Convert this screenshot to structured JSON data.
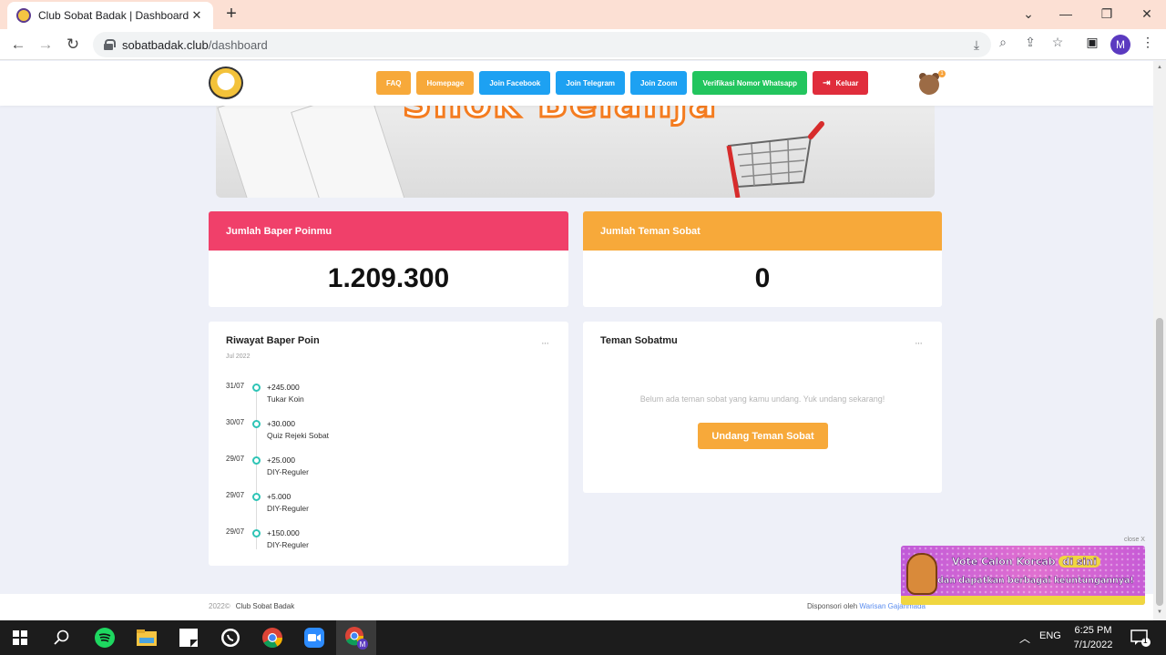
{
  "browser": {
    "tab_title": "Club Sobat Badak | Dashboard",
    "url_host": "sobatbadak.club",
    "url_path": "/dashboard",
    "profile_initial": "M"
  },
  "header": {
    "nav": [
      {
        "label": "FAQ",
        "color": "#f7a93a"
      },
      {
        "label": "Homepage",
        "color": "#f7a93a"
      },
      {
        "label": "Join Facebook",
        "color": "#1da1f2"
      },
      {
        "label": "Join Telegram",
        "color": "#1da1f2"
      },
      {
        "label": "Join Zoom",
        "color": "#1da1f2"
      },
      {
        "label": "Verifikasi Nomor Whatsapp",
        "color": "#22c55e"
      },
      {
        "label": "Keluar",
        "color": "#e02d3c"
      }
    ],
    "notification_count": "1"
  },
  "stats": {
    "points_title": "Jumlah Baper Poinmu",
    "points_value": "1.209.300",
    "points_color": "#f0406a",
    "friends_title": "Jumlah Teman Sobat",
    "friends_value": "0",
    "friends_color": "#f7a93a"
  },
  "history": {
    "title": "Riwayat Baper Poin",
    "subtitle": "Jul 2022",
    "menu": "···",
    "items": [
      {
        "date": "31/07",
        "amount": "+245.000",
        "desc": "Tukar Koin"
      },
      {
        "date": "30/07",
        "amount": "+30.000",
        "desc": "Quiz Rejeki Sobat"
      },
      {
        "date": "29/07",
        "amount": "+25.000",
        "desc": "DIY-Reguler"
      },
      {
        "date": "29/07",
        "amount": "+5.000",
        "desc": "DIY-Reguler"
      },
      {
        "date": "29/07",
        "amount": "+150.000",
        "desc": "DIY-Reguler"
      }
    ]
  },
  "friends": {
    "title": "Teman Sobatmu",
    "menu": "···",
    "empty_text": "Belum ada teman sobat yang kamu undang. Yuk undang sekarang!",
    "invite_label": "Undang Teman Sobat"
  },
  "footer": {
    "year": "2022©",
    "brand": "Club Sobat Badak",
    "sponsor_prefix": "Disponsori oleh",
    "sponsor_link": "Warisan Gajahmada"
  },
  "promo": {
    "close": "close X",
    "line1": "Vote Calon Korcab",
    "line1_badge": "di sini",
    "line2": "dan dapatkan berbagai keuntungannya!"
  },
  "taskbar": {
    "lang": "ENG",
    "time": "6:25 PM",
    "date": "7/1/2022",
    "notif_count": "1"
  }
}
